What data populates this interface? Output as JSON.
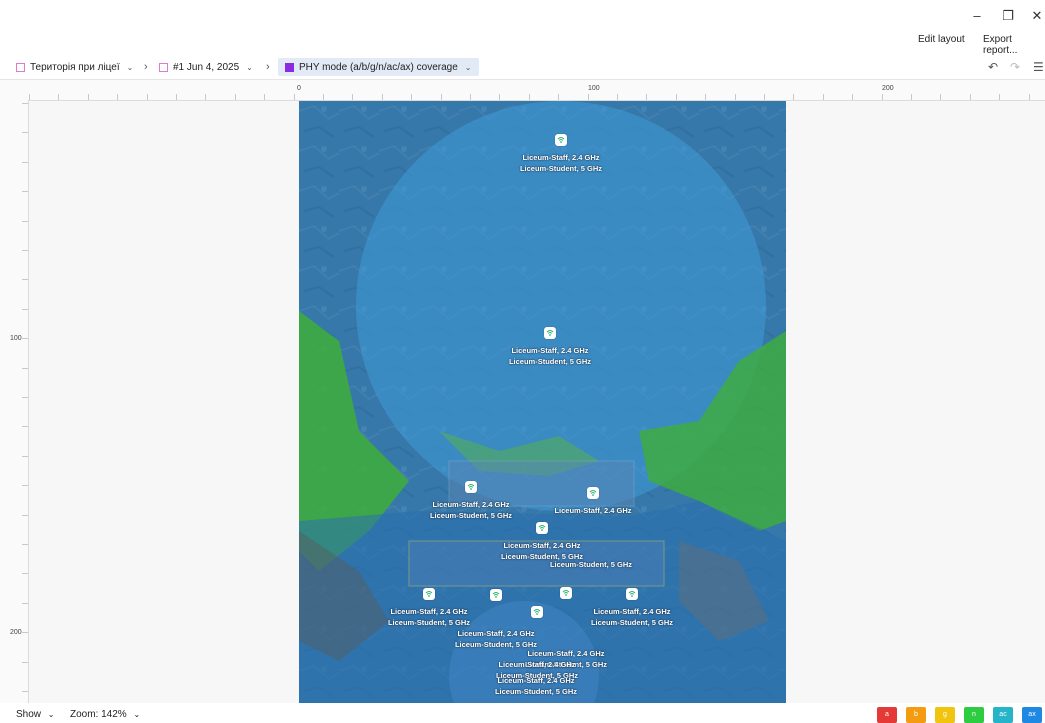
{
  "window": {
    "minimize_icon": "minimize-icon",
    "restore_icon": "restore-icon",
    "close_icon": "close-icon"
  },
  "header": {
    "edit_layout": "Edit layout",
    "export_report": "Export report..."
  },
  "breadcrumb": {
    "items": [
      {
        "label": "Територія при ліцеї",
        "icon": "floor-plan-icon"
      },
      {
        "label": "#1 Jun 4, 2025",
        "icon": "survey-icon"
      },
      {
        "label": "PHY mode (a/b/g/n/ac/ax) coverage",
        "icon": "visualization-icon",
        "color": "#8a2be2"
      }
    ]
  },
  "toolbar_right": {
    "undo_icon": "undo-icon",
    "redo_icon": "redo-icon",
    "settings_icon": "sliders-icon"
  },
  "ruler": {
    "h_labels": [
      {
        "text": "0"
      },
      {
        "text": "100"
      },
      {
        "text": "200"
      }
    ],
    "v_labels": [
      {
        "text": "100"
      },
      {
        "text": "200"
      }
    ]
  },
  "access_points": [
    {
      "lines": [
        "Liceum-Staff, 2.4 GHz",
        "Liceum-Student, 5 GHz"
      ]
    },
    {
      "lines": [
        "Liceum-Staff, 2.4 GHz",
        "Liceum-Student, 5 GHz"
      ]
    },
    {
      "lines": [
        "Liceum-Staff, 2.4 GHz",
        "Liceum-Student, 5 GHz"
      ]
    },
    {
      "lines": [
        "Liceum-Staff, 2.4 GHz"
      ]
    },
    {
      "lines": [
        "Liceum-Staff, 2.4 GHz",
        "Liceum-Student, 5 GHz"
      ]
    },
    {
      "lines": [
        "Liceum-Student, 5 GHz"
      ]
    },
    {
      "lines": [
        "Liceum-Staff, 2.4 GHz",
        "Liceum-Student, 5 GHz"
      ]
    },
    {
      "lines": [
        "Liceum-Staff, 2.4 GHz",
        "Liceum-Student, 5 GHz"
      ]
    },
    {
      "lines": [
        "Liceum-Staff, 2.4 GHz",
        "Liceum-Student, 5 GHz"
      ]
    },
    {
      "lines": [
        "Liceum-Staff, 2.4 GHz",
        "Liceum-Student, 5 GHz"
      ]
    },
    {
      "lines": [
        "Liceum-Staff, 2.4 GHz",
        "Liceum-Student, 5 GHz"
      ]
    },
    {
      "lines": [
        "Liceum-Staff, 2.4 GHz",
        "Liceum-Student, 5 GHz"
      ]
    }
  ],
  "footer": {
    "show": "Show",
    "zoom": "Zoom: 142%"
  },
  "phy_legend": [
    {
      "label": "a",
      "color": "#e53935"
    },
    {
      "label": "b",
      "color": "#f39c12"
    },
    {
      "label": "g",
      "color": "#f1c40f"
    },
    {
      "label": "n",
      "color": "#2ecc40"
    },
    {
      "label": "ac",
      "color": "#26b5c8"
    },
    {
      "label": "ax",
      "color": "#1e88e5"
    }
  ],
  "colors": {
    "coverage_ax": "#1e88e5",
    "coverage_n": "#2ecc40",
    "accent": "#8a2be2"
  }
}
